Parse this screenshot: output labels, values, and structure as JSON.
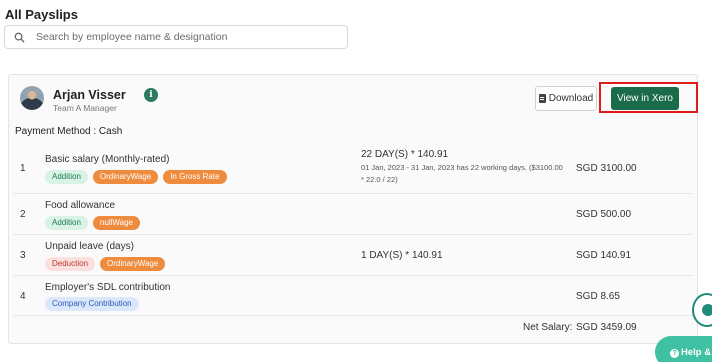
{
  "page": {
    "title": "All Payslips"
  },
  "search": {
    "placeholder": "Search by employee name & designation",
    "icon": "search-icon"
  },
  "employee": {
    "name": "Arjan Visser",
    "role": "Team A Manager",
    "info_icon_glyph": "i"
  },
  "actions": {
    "download_label": "Download",
    "xero_label": "View in Xero"
  },
  "payment_method": "Payment Method : Cash",
  "items": [
    {
      "index": "1",
      "title": "Basic salary (Monthly-rated)",
      "tags": [
        {
          "label": "Addition",
          "kind": "add"
        },
        {
          "label": "OrdinaryWage",
          "kind": "ord"
        },
        {
          "label": "In Gross Rate",
          "kind": "ord"
        }
      ],
      "calc": "22 DAY(S) * 140.91",
      "calc_note": "01 Jan, 2023 - 31 Jan, 2023 has 22 working days. ($3100.00 * 22.0 / 22)",
      "amount": "SGD 3100.00"
    },
    {
      "index": "2",
      "title": "Food allowance",
      "tags": [
        {
          "label": "Addition",
          "kind": "add"
        },
        {
          "label": "nullWage",
          "kind": "ord"
        }
      ],
      "calc": "",
      "calc_note": "",
      "amount": "SGD 500.00"
    },
    {
      "index": "3",
      "title": "Unpaid leave (days)",
      "tags": [
        {
          "label": "Deduction",
          "kind": "ded"
        },
        {
          "label": "OrdinaryWage",
          "kind": "ord"
        }
      ],
      "calc": "1 DAY(S) * 140.91",
      "calc_note": "",
      "amount": "SGD 140.91"
    },
    {
      "index": "4",
      "title": "Employer's SDL contribution",
      "tags": [
        {
          "label": "Company Contribution",
          "kind": "comp"
        }
      ],
      "calc": "",
      "calc_note": "",
      "amount": "SGD 8.65"
    }
  ],
  "net_salary": {
    "label": "Net Salary:",
    "value": "SGD 3459.09"
  },
  "help": {
    "label": "Help & S"
  },
  "colors": {
    "primary": "#1a6b49",
    "highlight": "#e01b1b",
    "help": "#41c1a3",
    "tag_orange": "#ef8b3d"
  }
}
